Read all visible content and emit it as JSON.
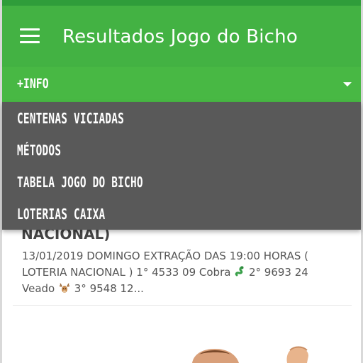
{
  "app": {
    "title": "Resultados Jogo do Bicho"
  },
  "info_bar": {
    "label": "+INFO"
  },
  "menu": {
    "items": [
      {
        "label": "CENTENAS VICIADAS"
      },
      {
        "label": "MÉTODOS"
      },
      {
        "label": "TABELA JOGO DO BICHO"
      },
      {
        "label": "LOTERIAS CAIXA"
      }
    ]
  },
  "post": {
    "title_fragment": "NACIONAL)",
    "line1": "13/01/2019 DOMINGO EXTRAÇÃO DAS 19:00 HORAS (",
    "line2_a": "LOTERIA NACIONAL ) 1° 4533   09 Cobra ",
    "line2_b": " 2° 9693   24",
    "line3_a": "Veado ",
    "line3_b": " 3° 9548   12..."
  },
  "icons": {
    "snake": "snake-emoji",
    "deer": "deer-emoji"
  },
  "colors": {
    "app_bar": "#43b243",
    "info_bar": "#48b844",
    "menu_panel": "#595959"
  }
}
